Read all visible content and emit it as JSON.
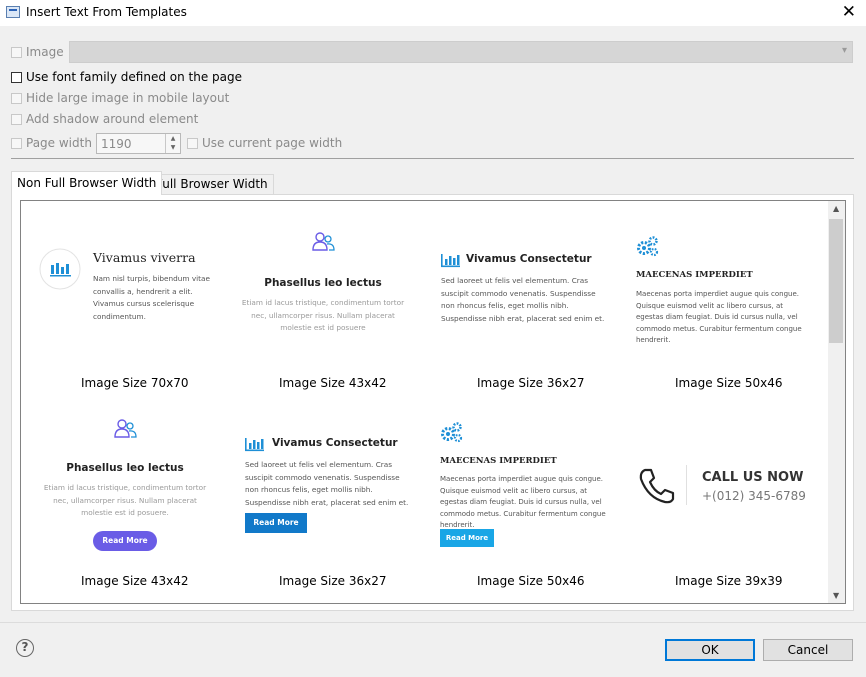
{
  "window": {
    "title": "Insert Text From Templates",
    "close": "✕"
  },
  "options": {
    "image_label": "Image",
    "font_family_label": "Use font family defined on the page",
    "hide_large_label": "Hide large image in mobile layout",
    "shadow_label": "Add shadow around element",
    "page_width_label": "Page width",
    "page_width_value": "1190",
    "current_width_label": "Use current page width"
  },
  "tabs": [
    "Non Full Browser Width",
    "Full Browser Width"
  ],
  "templates": [
    {
      "title": "Vivamus viverra",
      "text": "Nam nisl turpis, bibendum vitae convallis a, hendrerit a elit. Vivamus cursus scelerisque condimentum.",
      "caption": "Image Size 70x70",
      "icon": "bar-chart-circle-icon"
    },
    {
      "title": "Phasellus leo lectus",
      "text": "Etiam id lacus tristique, condimentum tortor nec, ullamcorper risus. Nullam placerat molestie est id posuere",
      "caption": "Image Size 43x42",
      "icon": "users-icon"
    },
    {
      "title": "Vivamus Consectetur",
      "text": "Sed laoreet ut felis vel elementum. Cras suscipit commodo venenatis. Suspendisse non rhoncus felis, eget mollis nibh. Suspendisse nibh erat, placerat sed enim et.",
      "caption": "Image Size 36x27",
      "icon": "bar-chart-icon"
    },
    {
      "title": "MAECENAS IMPERDIET",
      "text": "Maecenas porta imperdiet augue quis congue. Quisque euismod velit ac libero cursus, at egestas diam feugiat. Duis id cursus nulla, vel commodo metus. Curabitur fermentum congue hendrerit.",
      "caption": "Image Size 50x46",
      "icon": "gears-icon"
    },
    {
      "title": "Phasellus leo lectus",
      "text": "Etiam id lacus tristique, condimentum tortor nec, ullamcorper risus. Nullam placerat molestie est id posuere.",
      "button": "Read More",
      "caption": "Image Size 43x42",
      "icon": "users-icon"
    },
    {
      "title": "Vivamus Consectetur",
      "text": "Sed laoreet ut felis vel elementum. Cras suscipit commodo venenatis. Suspendisse non rhoncus felis, eget mollis nibh. Suspendisse nibh erat, placerat sed enim et.",
      "button": "Read More",
      "caption": "Image Size 36x27",
      "icon": "bar-chart-icon"
    },
    {
      "title": "MAECENAS IMPERDIET",
      "text": "Maecenas porta imperdiet augue quis congue. Quisque euismod velit ac libero cursus, at egestas diam feugiat. Duis id cursus nulla, vel commodo metus. Curabitur fermentum congue hendrerit.",
      "button": "Read More",
      "caption": "Image Size 50x46",
      "icon": "gears-icon"
    },
    {
      "title": "CALL US NOW",
      "text": "+(012) 345-6789",
      "caption": "Image Size 39x39",
      "icon": "phone-icon"
    }
  ],
  "colors": {
    "accent_blue": "#1e8fd6",
    "purple": "#6a5ce6",
    "button_blue": "#1179c9",
    "cyan": "#19a6e6"
  },
  "buttons": {
    "ok": "OK",
    "cancel": "Cancel",
    "help": "?"
  }
}
